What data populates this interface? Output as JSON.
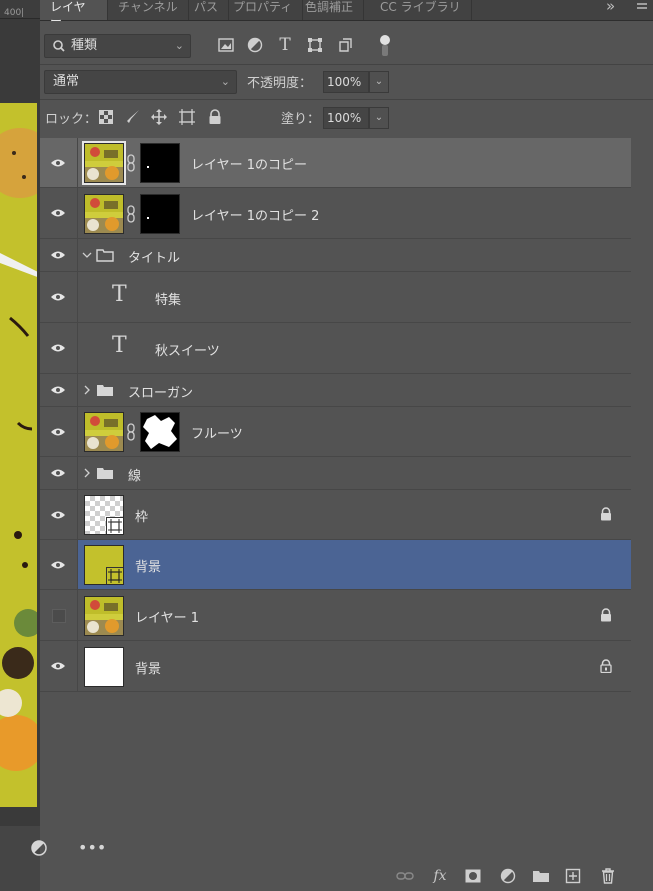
{
  "canvas": {
    "ruler_text": "400|"
  },
  "tabs": [
    {
      "label": "レイヤー",
      "active": true
    },
    {
      "label": "チャンネル",
      "active": false
    },
    {
      "label": "パス",
      "active": false
    },
    {
      "label": "プロパティ",
      "active": false
    },
    {
      "label": "色調補正",
      "active": false
    },
    {
      "label": "CC ライブラリ",
      "active": false
    }
  ],
  "tab_overflow": "»",
  "filter": {
    "icon": "search-icon",
    "value": "種類"
  },
  "blend": {
    "mode": "通常",
    "opacity_label": "不透明度：",
    "opacity_value": "100%"
  },
  "lock": {
    "label": "ロック：",
    "fill_label": "塗り：",
    "fill_value": "100%"
  },
  "layers": [
    {
      "name": "レイヤー 1のコピー",
      "type": "image-mask",
      "visible": true,
      "selected": true
    },
    {
      "name": "レイヤー 1のコピー 2",
      "type": "image-mask",
      "visible": true
    },
    {
      "name": "タイトル",
      "type": "group",
      "expanded": true,
      "visible": true
    },
    {
      "name": "特集",
      "type": "text",
      "visible": true
    },
    {
      "name": "秋スイーツ",
      "type": "text",
      "visible": true
    },
    {
      "name": "スローガン",
      "type": "group",
      "expanded": false,
      "visible": true
    },
    {
      "name": "フルーツ",
      "type": "image-mask",
      "visible": true
    },
    {
      "name": "線",
      "type": "group",
      "expanded": false,
      "visible": true
    },
    {
      "name": "枠",
      "type": "frame",
      "visible": true,
      "locked": true
    },
    {
      "name": "背景",
      "type": "frame-fill",
      "visible": true,
      "active": true
    },
    {
      "name": "レイヤー 1",
      "type": "image",
      "visible": false,
      "locked": true
    },
    {
      "name": "背景",
      "type": "background",
      "visible": true,
      "locked": true
    }
  ],
  "colors": {
    "panel": "#535353",
    "active_row": "#4b6494",
    "selected_row": "#676767",
    "doc": "#c3c12c"
  }
}
